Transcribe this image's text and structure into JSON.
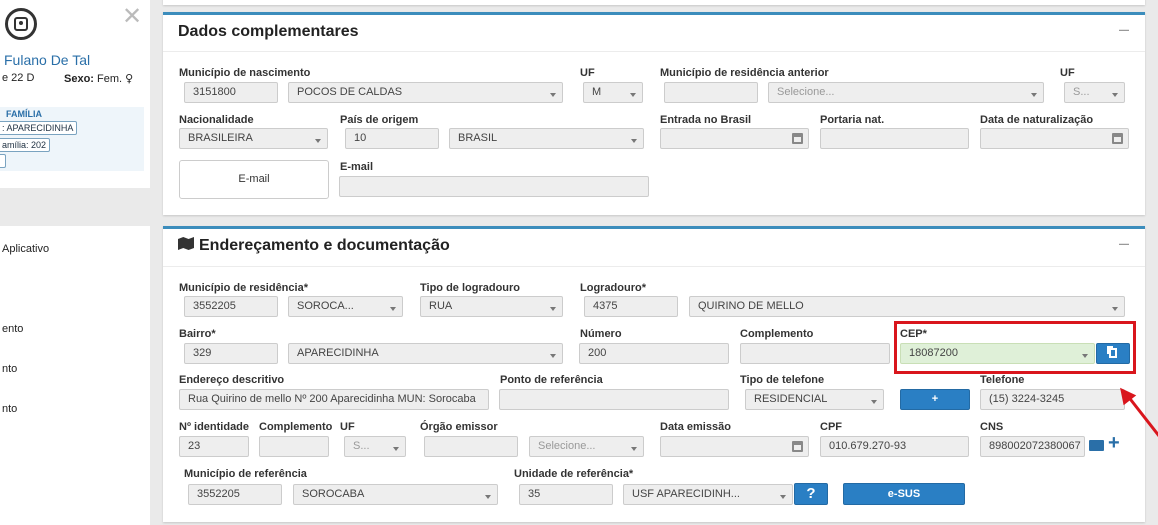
{
  "sidebar": {
    "name": "Fulano De Tal",
    "age": "e 22 D",
    "sex_label": "Sexo:",
    "sex_value": "Fem.",
    "family_title": "FAMÍLIA",
    "chip1": ": APARECIDINHA",
    "chip2": "amília: 202",
    "menu": [
      "Aplicativo",
      "ento",
      "nto",
      "nto"
    ]
  },
  "panel1": {
    "title": "Dados complementares",
    "minimize": "–",
    "mun_nasc_label": "Município de nascimento",
    "mun_nasc_code": "3151800",
    "mun_nasc_name": "POCOS DE CALDAS",
    "uf_label": "UF",
    "uf_value": "M",
    "mun_res_ant_label": "Município de residência anterior",
    "mun_res_ant_placeholder": "Selecione...",
    "uf2_label": "UF",
    "uf2_placeholder": "S...",
    "nac_label": "Nacionalidade",
    "nac_value": "BRASILEIRA",
    "pais_label": "País de origem",
    "pais_code": "10",
    "pais_name": "BRASIL",
    "entrada_label": "Entrada no Brasil",
    "portaria_label": "Portaria nat.",
    "data_nat_label": "Data de naturalização",
    "email_button": "E-mail",
    "email_label": "E-mail"
  },
  "panel2": {
    "title": "Endereçamento e documentação",
    "minimize": "–",
    "mun_res_label": "Município de residência*",
    "mun_res_code": "3552205",
    "mun_res_name": "SOROCA...",
    "tipo_log_label": "Tipo de logradouro",
    "tipo_log_value": "RUA",
    "logradouro_label": "Logradouro*",
    "logradouro_code": "4375",
    "logradouro_name": "QUIRINO DE MELLO",
    "bairro_label": "Bairro*",
    "bairro_code": "329",
    "bairro_name": "APARECIDINHA",
    "numero_label": "Número",
    "numero_value": "200",
    "complemento_label": "Complemento",
    "cep_label": "CEP*",
    "cep_value": "18087200",
    "end_desc_label": "Endereço descritivo",
    "end_desc_value": "Rua Quirino de mello  Nº 200  Aparecidinha  MUN: Sorocaba",
    "ponto_ref_label": "Ponto de referência",
    "tipo_tel_label": "Tipo de telefone",
    "tipo_tel_value": "RESIDENCIAL",
    "add_button": "+",
    "telefone_label": "Telefone",
    "telefone_value": "(15) 3224-3245",
    "nid_label": "Nº identidade",
    "nid_value": "23",
    "comp_label": "Complemento",
    "uf_label": "UF",
    "uf_placeholder": "S...",
    "orgao_label": "Órgão emissor",
    "orgao_placeholder": "Selecione...",
    "data_emissao_label": "Data emissão",
    "cpf_label": "CPF",
    "cpf_value": "010.679.270-93",
    "cns_label": "CNS",
    "cns_value": "898002072380067",
    "mun_ref_label": "Município de referência",
    "mun_ref_code": "3552205",
    "mun_ref_name": "SOROCABA",
    "unid_ref_label": "Unidade de referência*",
    "unid_ref_code": "35",
    "unid_ref_name": "USF APARECIDINH...",
    "help_button": "?",
    "esus_button": "e-SUS"
  },
  "colors": {
    "accent": "#3c8dbc",
    "button": "#2a7fc4",
    "highlight": "#d9161d",
    "cep_bg": "#dff0d8"
  }
}
